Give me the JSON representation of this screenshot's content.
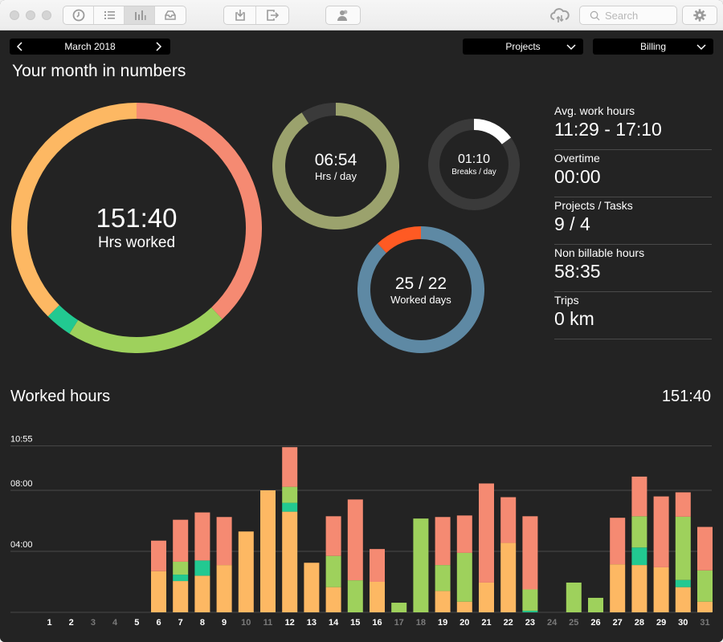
{
  "toolbar": {
    "view_buttons": [
      {
        "name": "clock-icon",
        "active": false
      },
      {
        "name": "list-icon",
        "active": false
      },
      {
        "name": "bar-chart-icon",
        "active": true
      },
      {
        "name": "inbox-icon",
        "active": false
      }
    ],
    "search_placeholder": "Search"
  },
  "period": {
    "label": "March 2018"
  },
  "filters": {
    "projects": "Projects",
    "billing": "Billing"
  },
  "section_title": "Your month in numbers",
  "rings": {
    "total": {
      "value": "151:40",
      "label": "Hrs worked",
      "segments": [
        {
          "color": "#f58a72",
          "fraction": 0.38
        },
        {
          "color": "#9ed15c",
          "fraction": 0.21
        },
        {
          "color": "#22c991",
          "fraction": 0.035
        },
        {
          "color": "#fdb863",
          "fraction": 0.375
        }
      ]
    },
    "per_day": {
      "value": "06:54",
      "label": "Hrs / day",
      "color": "#9ba26d",
      "track": "#3a3a3a",
      "fraction": 0.91
    },
    "breaks": {
      "value": "01:10",
      "label": "Breaks / day",
      "color": "#ffffff",
      "track": "#3a3a3a",
      "fraction": 0.15
    },
    "days": {
      "value": "25 / 22",
      "label": "Worked days",
      "color": "#5e89a4",
      "over_color": "#ff5a23",
      "over_fraction": 0.12
    }
  },
  "stats": [
    {
      "label": "Avg. work hours",
      "value": "11:29 - 17:10"
    },
    {
      "label": "Overtime",
      "value": "00:00"
    },
    {
      "label": "Projects / Tasks",
      "value": "9 / 4"
    },
    {
      "label": "Non billable hours",
      "value": "58:35"
    },
    {
      "label": "Trips",
      "value": "0 km"
    }
  ],
  "worked_hours": {
    "title": "Worked hours",
    "total": "151:40"
  },
  "chart_data": {
    "type": "bar",
    "stacked": true,
    "title": "Worked hours",
    "xlabel": "",
    "ylabel": "",
    "ylim": [
      0,
      10.917
    ],
    "y_ticks": [
      {
        "value": 4,
        "label": "04:00"
      },
      {
        "value": 8,
        "label": "08:00"
      },
      {
        "value": 10.917,
        "label": "10:55"
      }
    ],
    "grid": true,
    "categories": [
      "1",
      "2",
      "3",
      "4",
      "5",
      "6",
      "7",
      "8",
      "9",
      "10",
      "11",
      "12",
      "13",
      "14",
      "15",
      "16",
      "17",
      "18",
      "19",
      "20",
      "21",
      "22",
      "23",
      "24",
      "25",
      "26",
      "27",
      "28",
      "29",
      "30",
      "31"
    ],
    "weekend_days": [
      "3",
      "4",
      "10",
      "11",
      "17",
      "18",
      "24",
      "25",
      "31"
    ],
    "series": [
      {
        "name": "orange",
        "color": "#fdb863",
        "values": [
          0,
          0,
          0,
          0,
          0,
          2.7,
          2.05,
          2.4,
          3.1,
          5.3,
          8.0,
          6.6,
          3.25,
          1.65,
          0,
          2.0,
          0,
          0,
          1.4,
          0.7,
          1.95,
          4.55,
          0,
          0,
          0,
          0,
          3.15,
          3.1,
          2.95,
          1.65,
          0.7
        ]
      },
      {
        "name": "teal",
        "color": "#22c991",
        "values": [
          0,
          0,
          0,
          0,
          0,
          0,
          0.42,
          1.0,
          0,
          0,
          0,
          0.58,
          0,
          0,
          0,
          0,
          0,
          0,
          0,
          0,
          0,
          0,
          0.1,
          0,
          0,
          0,
          0,
          1.15,
          0,
          0.47,
          0
        ]
      },
      {
        "name": "green",
        "color": "#9ed15c",
        "values": [
          0,
          0,
          0,
          0,
          0,
          0,
          0.85,
          0,
          0,
          0,
          0,
          1.05,
          0,
          2.05,
          2.1,
          0,
          0.63,
          6.15,
          1.7,
          3.2,
          0,
          0,
          1.4,
          0,
          1.95,
          0.95,
          0,
          2.05,
          0,
          4.15,
          2.05
        ]
      },
      {
        "name": "salmon",
        "color": "#f58a72",
        "values": [
          0,
          0,
          0,
          0,
          0,
          2.0,
          2.75,
          3.15,
          3.15,
          0,
          0,
          2.6,
          0,
          2.6,
          5.3,
          2.15,
          0,
          0,
          3.15,
          2.45,
          6.5,
          3.0,
          4.8,
          0,
          0,
          0,
          3.05,
          2.6,
          4.65,
          1.6,
          2.85
        ]
      }
    ]
  }
}
